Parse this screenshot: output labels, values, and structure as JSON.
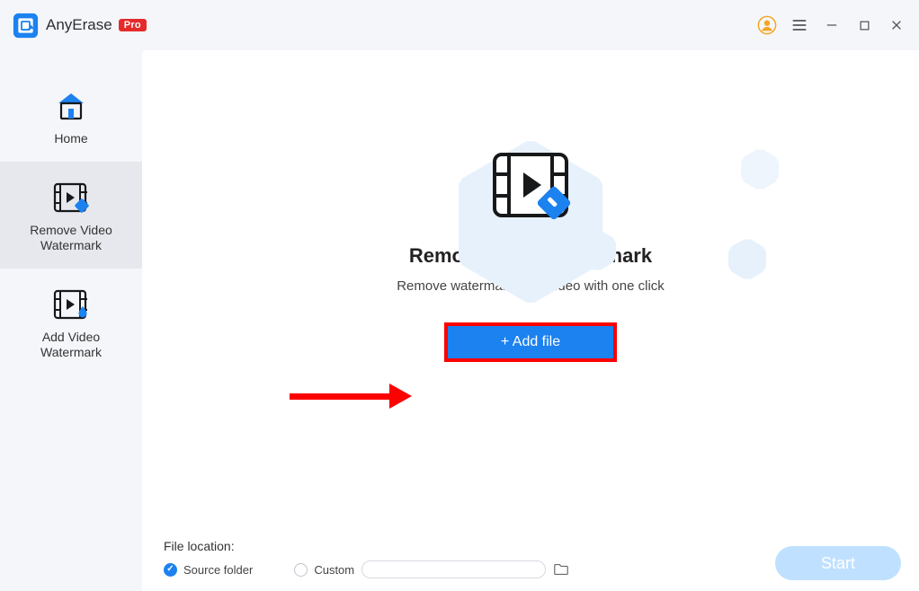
{
  "app": {
    "title": "AnyErase",
    "badge": "Pro"
  },
  "sidebar": {
    "items": [
      {
        "label": "Home"
      },
      {
        "label": "Remove Video\nWatermark"
      },
      {
        "label": "Add Video\nWatermark"
      }
    ]
  },
  "hero": {
    "title": "Remove Video Watermark",
    "subtitle": "Remove watermark from video with one click",
    "addfile_label": "+ Add file"
  },
  "footer": {
    "label": "File location:",
    "option_source": "Source folder",
    "option_custom": "Custom",
    "custom_path": "",
    "start_label": "Start"
  }
}
